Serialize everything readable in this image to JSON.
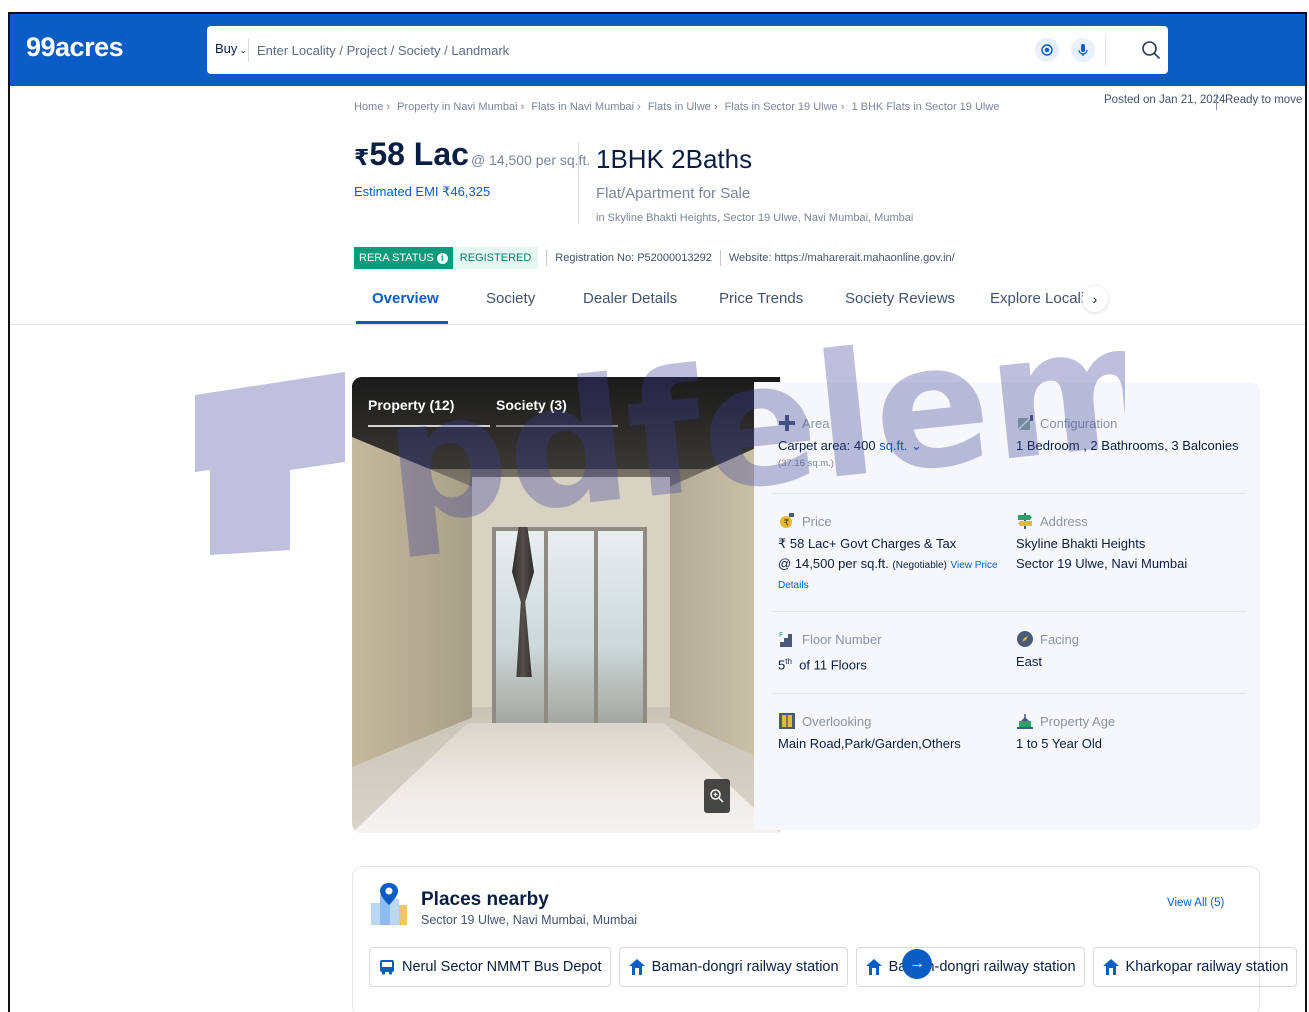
{
  "header": {
    "logo": "99acres",
    "buy_label": "Buy",
    "search_placeholder": "Enter Locality / Project / Society / Landmark"
  },
  "listing": {
    "posted": "Posted on Jan 21, 2024",
    "status": "Ready to move",
    "breadcrumb": [
      "Home ›",
      "Property in Navi Mumbai ›",
      "Flats in Navi Mumbai ›",
      "Flats in Ulwe ›",
      "Flats in Sector 19 Ulwe ›",
      "1 BHK Flats in Sector 19 Ulwe"
    ],
    "price_symbol": "₹",
    "price": "58 Lac",
    "price_per": "@ 14,500 per sq.ft.",
    "emi": "Estimated EMI ₹46,325",
    "title": "1BHK 2Baths",
    "subtitle": "Flat/Apartment for Sale",
    "location": "in Skyline Bhakti Heights, Sector 19 Ulwe, Navi Mumbai, Mumbai",
    "rera_label": "RERA STATUS",
    "rera_status": "REGISTERED",
    "registration": "Registration No: P52000013292",
    "website": "Website: https://maharerait.mahaonline.gov.in/"
  },
  "tabs": [
    "Overview",
    "Society",
    "Dealer Details",
    "Price Trends",
    "Society Reviews",
    "Explore Locality"
  ],
  "gallery": {
    "tab_property": "Property (12)",
    "tab_society": "Society (3)"
  },
  "details": {
    "area_label": "Area",
    "area_value": "Carpet area: 400",
    "area_unit": "sq.ft.",
    "area_sub": "(37.16 sq.m.)",
    "config_label": "Configuration",
    "config_value": "1 Bedroom , 2 Bathrooms, 3 Balconies",
    "price_label": "Price",
    "price_value": "₹ 58 Lac+ Govt Charges & Tax",
    "price_per": "@ 14,500 per sq.ft.",
    "price_negotiable": "(Negotiable)",
    "price_link_1": "View Price",
    "price_link_2": "Details",
    "address_label": "Address",
    "address_line1": "Skyline Bhakti Heights",
    "address_line2": "Sector 19 Ulwe, Navi Mumbai",
    "floor_label": "Floor Number",
    "floor_num": "5",
    "floor_sup": "th",
    "floor_rest": "of 11 Floors",
    "facing_label": "Facing",
    "facing_value": "East",
    "overlooking_label": "Overlooking",
    "overlooking_value": "Main Road,Park/Garden,Others",
    "age_label": "Property Age",
    "age_value": "1 to 5 Year Old"
  },
  "places": {
    "title": "Places nearby",
    "subtitle": "Sector 19 Ulwe, Navi Mumbai, Mumbai",
    "view_all": "View All (5)",
    "chips": [
      "Nerul Sector NMMT Bus Depot",
      "Baman-dongri railway station",
      "Baman-dongri railway station",
      "Kharkopar railway station"
    ]
  },
  "watermark": "pdfelement",
  "colors": {
    "brand_blue": "#0b5cc4",
    "rera_green": "#0a9b7a",
    "watermark": "#3d3f99"
  }
}
